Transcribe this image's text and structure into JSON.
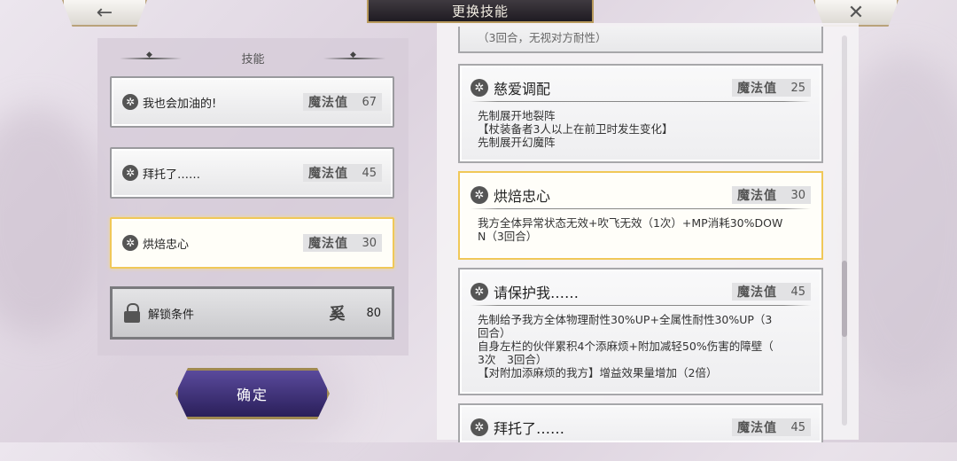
{
  "header": {
    "title": "更换技能",
    "back_icon": "←",
    "close_icon": "✕"
  },
  "left_panel": {
    "title": "技能",
    "slots": [
      {
        "name": "我也会加油的!",
        "cost_label": "魔法值",
        "cost": "67"
      },
      {
        "name": "拜托了……",
        "cost_label": "魔法值",
        "cost": "45"
      },
      {
        "name": "烘焙忠心",
        "cost_label": "魔法值",
        "cost": "30"
      }
    ],
    "unlock": {
      "label": "解锁条件",
      "symbol": "奚",
      "value": "80"
    },
    "confirm_label": "确定"
  },
  "right_panel": {
    "partial_top_text": "（3回合，无视对方耐性）",
    "cards": [
      {
        "name": "慈爱调配",
        "cost_label": "魔法值",
        "cost": "25",
        "desc": "先制展开地裂阵\n【杖装备者3人以上在前卫时发生变化】\n先制展开幻魔阵"
      },
      {
        "name": "烘焙忠心",
        "cost_label": "魔法值",
        "cost": "30",
        "desc": "我方全体异常状态无效+吹飞无效（1次）+MP消耗30%DOW\nN（3回合）"
      },
      {
        "name": "请保护我……",
        "cost_label": "魔法值",
        "cost": "45",
        "desc": "先制给予我方全体物理耐性30%UP+全属性耐性30%UP（3\n回合）\n自身左栏的伙伴累积4个添麻烦+附加减轻50%伤害的障壁（\n3次　3回合）\n【对附加添麻烦的我方】增益效果量增加（2倍）"
      },
      {
        "name": "拜托了……",
        "cost_label": "魔法值",
        "cost": "45",
        "desc": ""
      }
    ]
  },
  "icons": {
    "skill": "gear-icon",
    "lock": "lock-icon"
  }
}
